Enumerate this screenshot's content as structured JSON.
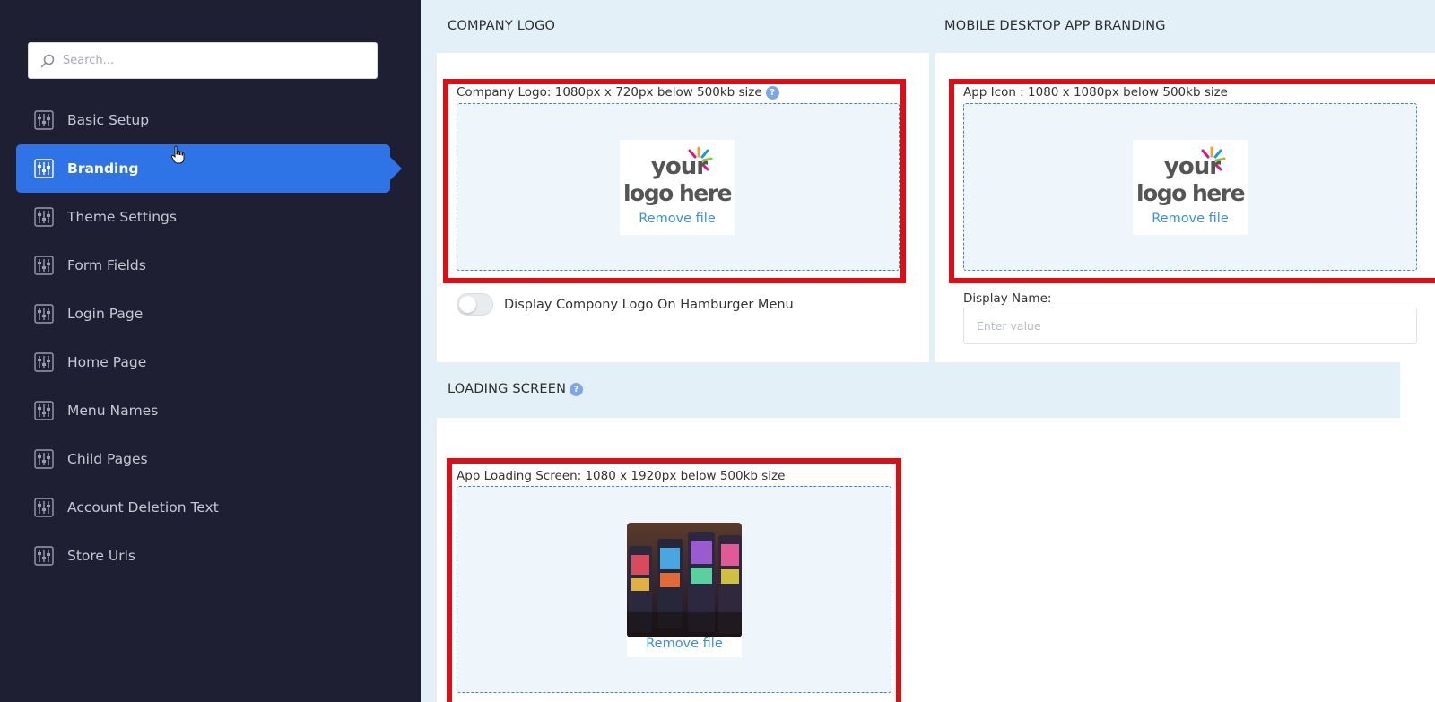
{
  "sidebar": {
    "search_placeholder": "Search...",
    "items": [
      {
        "label": "Basic Setup"
      },
      {
        "label": "Branding"
      },
      {
        "label": "Theme Settings"
      },
      {
        "label": "Form Fields"
      },
      {
        "label": "Login Page"
      },
      {
        "label": "Home Page"
      },
      {
        "label": "Menu Names"
      },
      {
        "label": "Child Pages"
      },
      {
        "label": "Account Deletion Text"
      },
      {
        "label": "Store Urls"
      }
    ],
    "active_index": 1
  },
  "company_logo": {
    "title": "COMPANY LOGO",
    "label": "Company Logo: 1080px x 720px below 500kb size",
    "remove_label": "Remove file",
    "toggle_label": "Display Compony Logo On Hamburger Menu",
    "toggle_on": false
  },
  "mobile_branding": {
    "title": "MOBILE DESKTOP APP BRANDING",
    "app_icon_label": "App Icon : 1080 x 1080px below 500kb size",
    "remove_label": "Remove file",
    "display_name_label": "Display Name:",
    "display_name_placeholder": "Enter value"
  },
  "loading_screen": {
    "title": "LOADING SCREEN",
    "label": "App Loading Screen: 1080 x 1920px below 500kb size",
    "remove_label": "Remove file"
  },
  "placeholder_logo": {
    "line1": "your",
    "line2": "logo here"
  },
  "help_glyph": "?",
  "colors": {
    "sidebar_bg": "#1f1f33",
    "accent": "#2f74e6",
    "highlight_frame": "#e00d14",
    "link": "#3b8ee0"
  }
}
